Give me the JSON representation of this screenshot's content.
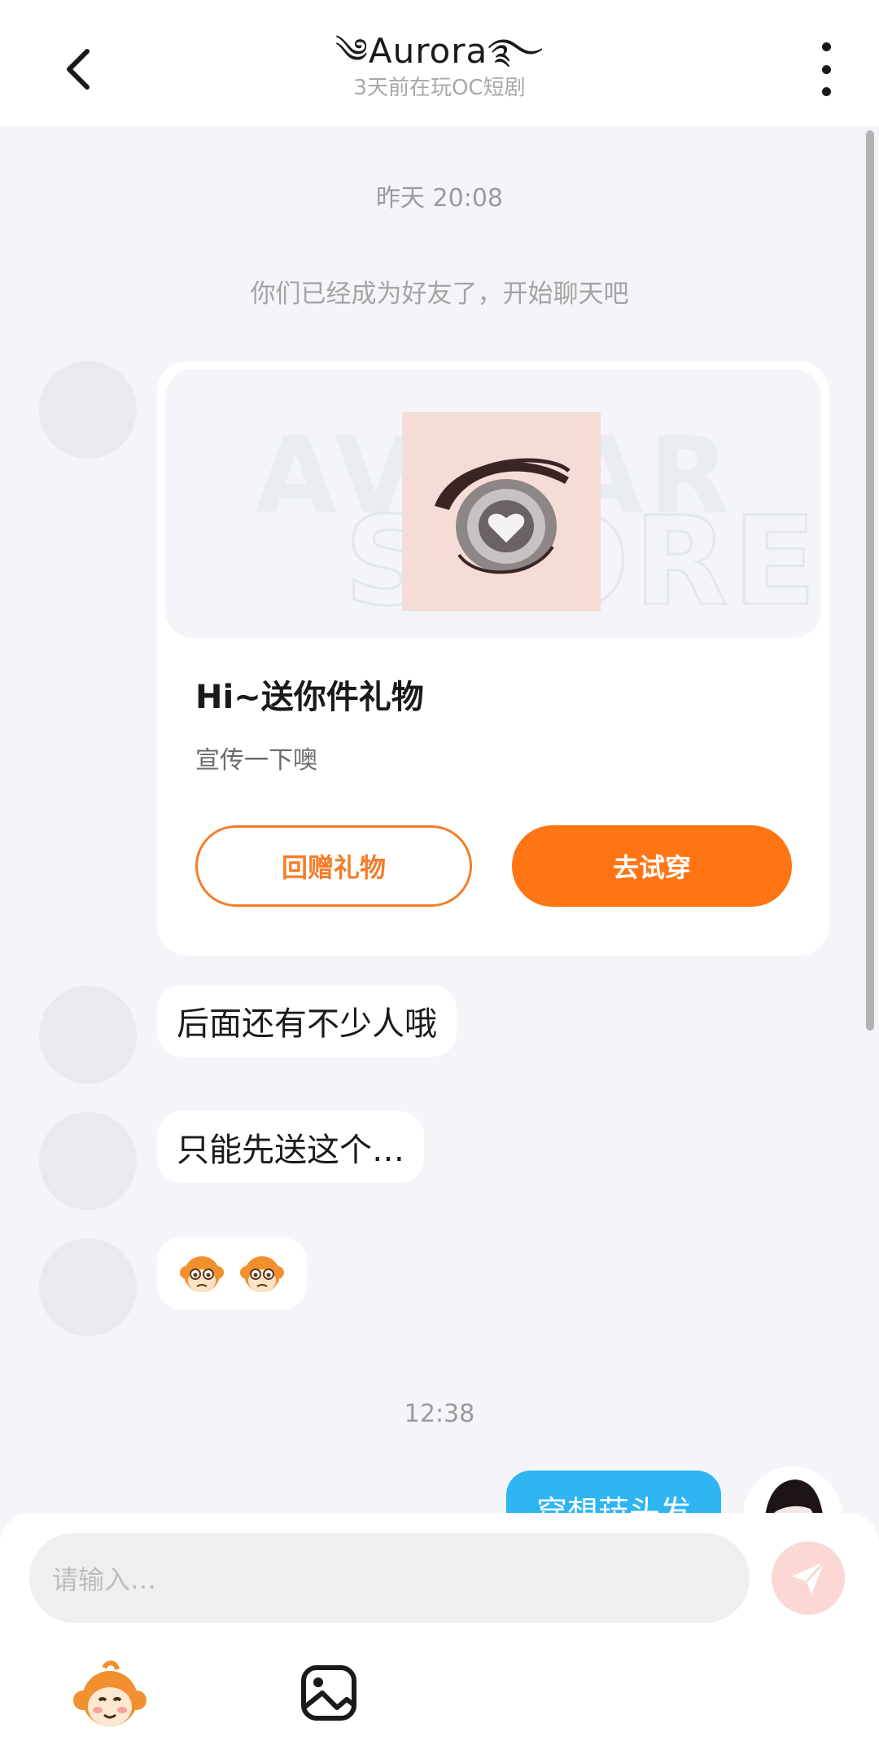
{
  "header": {
    "title": "༄Aurora࿐",
    "subtitle": "3天前在玩OC短剧"
  },
  "chat": {
    "time_1": "昨天 20:08",
    "system_notice": "你们已经成为好友了，开始聊天吧",
    "gift_card": {
      "title": "Hi~送你件礼物",
      "desc": "宣传一下噢",
      "btn_return": "回赠礼物",
      "btn_try": "去试穿"
    },
    "messages": [
      "后面还有不少人哦",
      "只能先送这个…"
    ],
    "time_2": "12:38",
    "outgoing_message": "穿想菈头发"
  },
  "input": {
    "placeholder": "请输入…"
  },
  "icons": {
    "back": "chevron-left-icon",
    "more": "more-vertical-icon",
    "send": "send-icon",
    "emoji": "monkey-emoji-icon",
    "image": "image-icon"
  },
  "colors": {
    "accent_orange": "#ff7514",
    "outline_orange": "#f47d2a",
    "outgoing_blue": "#2fb5f2",
    "send_disabled": "#fbd8d4"
  }
}
